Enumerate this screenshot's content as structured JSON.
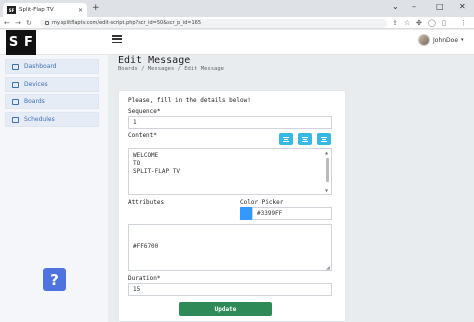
{
  "browser": {
    "tab_title": "Split-Flap TV",
    "tab_close": "✕",
    "new_tab": "+",
    "url": "my.splitflaptv.com/edit-script.php?scr_id=50&scr_p_id=165",
    "window_controls": {
      "collapse": "⌄",
      "minimize": "–",
      "maximize": "□",
      "close": "✕"
    },
    "nav": {
      "back": "←",
      "forward": "→",
      "reload": "↻"
    },
    "toolbar_icons": [
      "share-icon",
      "star-icon",
      "puzzle-icon",
      "profile-icon",
      "sidebar-icon",
      "menu-icon"
    ]
  },
  "app": {
    "logo_letters": [
      "S",
      "F"
    ],
    "user": {
      "name": "JohnDoe",
      "caret": "▾"
    }
  },
  "sidebar": {
    "items": [
      {
        "label": "Dashboard",
        "icon": "grid-icon"
      },
      {
        "label": "Devices",
        "icon": "monitor-icon"
      },
      {
        "label": "Boards",
        "icon": "board-icon"
      },
      {
        "label": "Schedules",
        "icon": "calendar-icon"
      }
    ],
    "help_label": "?"
  },
  "page": {
    "title": "Edit Message",
    "breadcrumb": "Boards / Messages / Edit Message"
  },
  "form": {
    "intro": "Please, fill in the details below!",
    "sequence": {
      "label": "Sequence*",
      "value": "1"
    },
    "content": {
      "label": "Content*",
      "lines": [
        "WELCOME",
        "TO",
        "SPLIT-FLAP TV"
      ],
      "align_buttons": [
        "align-left-icon",
        "align-center-icon",
        "align-right-icon"
      ]
    },
    "attributes": {
      "label": "Attributes",
      "value": "#FF6700"
    },
    "color_picker": {
      "label": "Color Picker",
      "value": "#3399FF",
      "swatch": "#3399FF"
    },
    "duration": {
      "label": "Duration*",
      "value": "15"
    },
    "submit_label": "Update"
  },
  "colors": {
    "accent": "#4e73df",
    "info": "#36b9e6",
    "success": "#2e8b57",
    "sidebar_text": "#3b6fb6"
  }
}
